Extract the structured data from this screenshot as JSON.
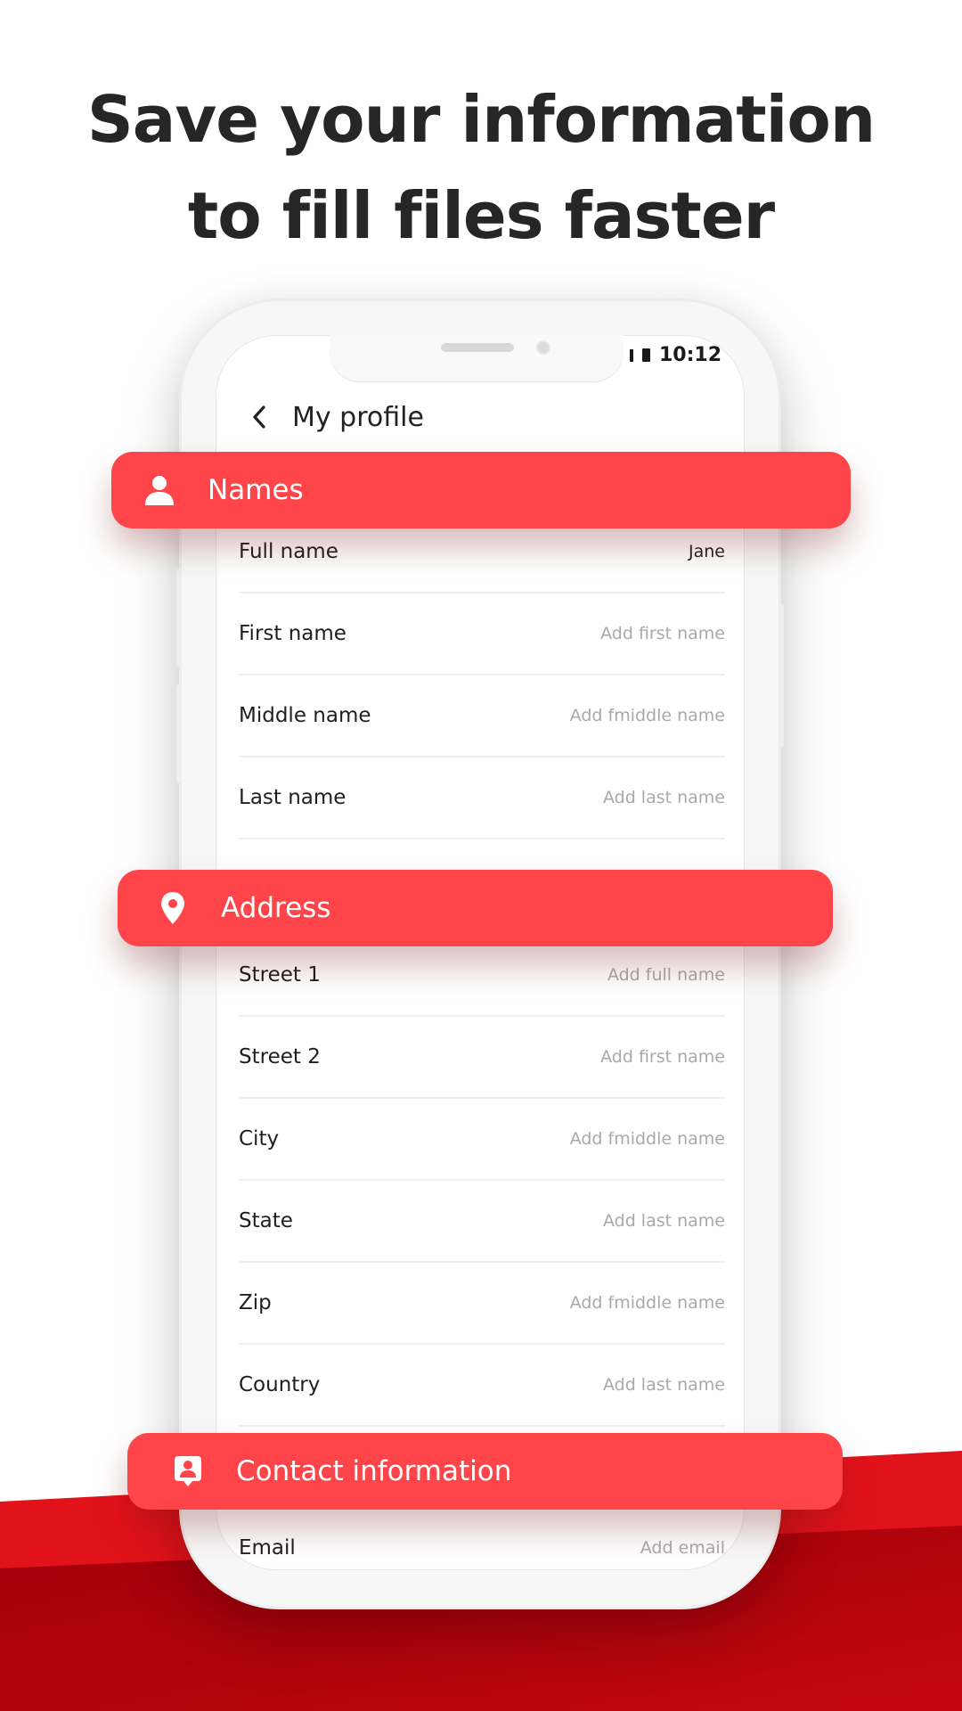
{
  "headline": {
    "line1": "Save your information",
    "line2": "to fill files faster"
  },
  "status_bar": {
    "time": "10:12",
    "icons": [
      "signal-icon",
      "battery-icon"
    ]
  },
  "header": {
    "back_icon": "chevron-left-icon",
    "title": "My profile"
  },
  "sections": {
    "names": {
      "label": "Names",
      "icon": "person-icon"
    },
    "address": {
      "label": "Address",
      "icon": "location-pin-icon"
    },
    "contact": {
      "label": "Contact information",
      "icon": "contact-card-icon"
    }
  },
  "names_fields": [
    {
      "label": "Full name",
      "value": "Jane"
    },
    {
      "label": "First name",
      "placeholder": "Add first name"
    },
    {
      "label": "Middle name",
      "placeholder": "Add fmiddle name"
    },
    {
      "label": "Last name",
      "placeholder": "Add last name"
    }
  ],
  "address_fields": [
    {
      "label": "Street 1",
      "placeholder": "Add full name"
    },
    {
      "label": "Street 2",
      "placeholder": "Add first name"
    },
    {
      "label": "City",
      "placeholder": "Add fmiddle name"
    },
    {
      "label": "State",
      "placeholder": "Add last name"
    },
    {
      "label": "Zip",
      "placeholder": "Add fmiddle name"
    },
    {
      "label": "Country",
      "placeholder": "Add last name"
    }
  ],
  "contact_fields": [
    {
      "label": "Email",
      "placeholder": "Add email"
    }
  ],
  "colors": {
    "accent_red": "#ff444a",
    "wave_red": "#d20a10",
    "wave_dark_red": "#a20008",
    "headline": "#262626"
  }
}
